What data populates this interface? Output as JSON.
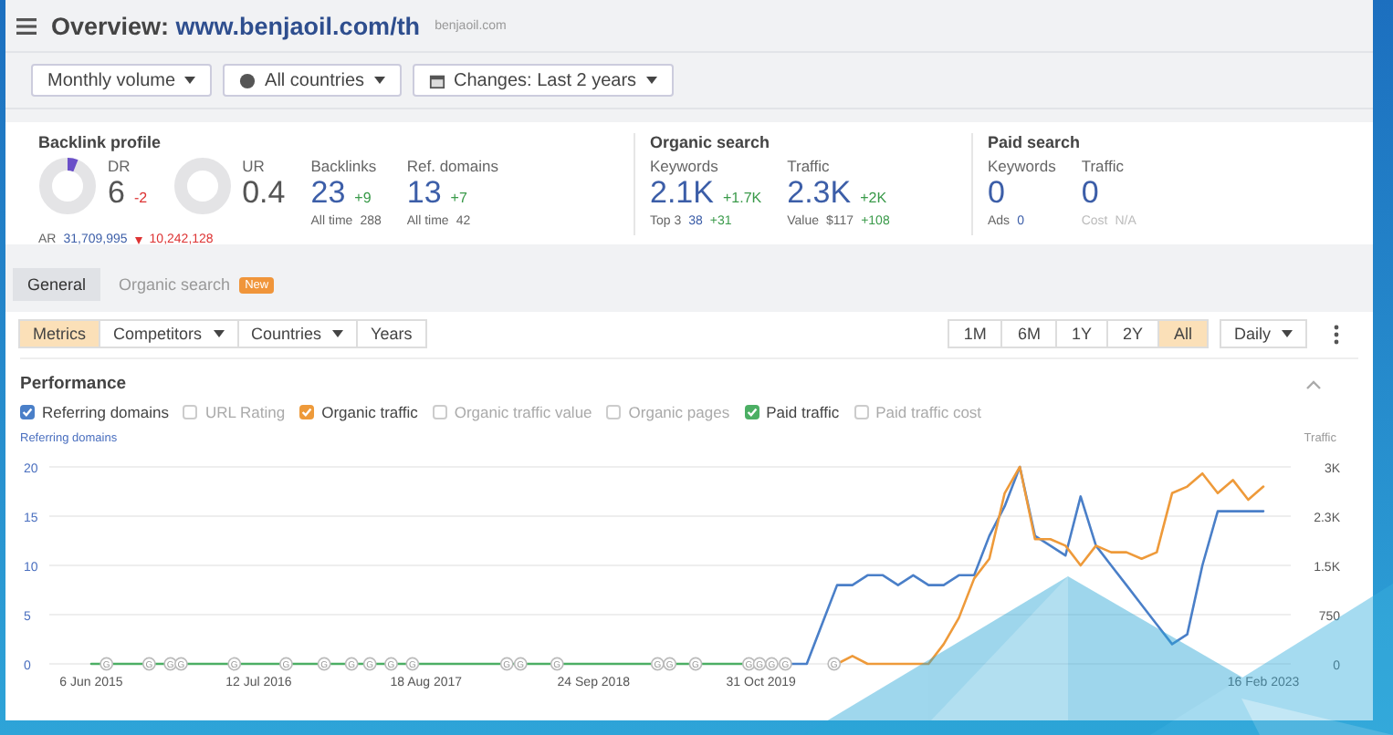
{
  "header": {
    "title": "Overview:",
    "url": "www.benjaoil.com/th",
    "domain": "benjaoil.com"
  },
  "filters": [
    {
      "label": "Monthly volume"
    },
    {
      "label": "All countries"
    },
    {
      "label": "Changes: Last 2 years"
    }
  ],
  "metric_groups": [
    {
      "title": "Backlink profile",
      "items": [
        {
          "kind": "gauge",
          "label": "DR",
          "value": "6",
          "change": "-2",
          "color": "#dd3333",
          "level": 0.06,
          "footer": {
            "label": "AR",
            "value": "31,709,995",
            "link": true,
            "change": "10,242,128",
            "color": "#dd3333"
          }
        },
        {
          "kind": "gauge",
          "label": "UR",
          "value": "0.4"
        },
        {
          "kind": "stat",
          "label": "Backlinks",
          "value": "23",
          "change": "+9",
          "color": "#3a9a4a",
          "footer": {
            "label": "All time",
            "value": "288",
            "link": false
          }
        },
        {
          "kind": "stat",
          "label": "Ref. domains",
          "value": "13",
          "change": "+7",
          "color": "#3a9a4a",
          "footer": {
            "label": "All time",
            "value": "42",
            "link": false
          }
        }
      ]
    },
    {
      "title": "Organic search",
      "items": [
        {
          "kind": "stat",
          "label": "Keywords",
          "value": "2.1K",
          "change": "+1.7K",
          "color": "#3a9a4a",
          "footer": {
            "label": "Top 3",
            "value": "38",
            "link": true,
            "change": "+31",
            "color": "#3a9a4a"
          }
        },
        {
          "kind": "stat",
          "label": "Traffic",
          "value": "2.3K",
          "change": "+2K",
          "color": "#3a9a4a",
          "footer": {
            "label": "Value",
            "value": "$117",
            "link": false,
            "change": "+108",
            "color": "#3a9a4a"
          }
        }
      ]
    },
    {
      "title": "Paid search",
      "items": [
        {
          "kind": "stat",
          "label": "Keywords",
          "value": "0",
          "footer": {
            "label": "Ads",
            "value": "0",
            "link": true
          }
        },
        {
          "kind": "stat",
          "label": "Traffic",
          "value": "0",
          "footer": {
            "label": "Cost",
            "value": "N/A",
            "link": false,
            "disabled": true
          }
        }
      ]
    }
  ],
  "tabs": [
    {
      "label": "General",
      "selected": true
    },
    {
      "label": "Organic search",
      "selected": false,
      "badge": "New"
    }
  ],
  "view_buttons": [
    {
      "label": "Metrics",
      "selected": true,
      "dropdown": false
    },
    {
      "label": "Competitors",
      "selected": false,
      "dropdown": true
    },
    {
      "label": "Countries",
      "selected": false,
      "dropdown": true
    },
    {
      "label": "Years",
      "selected": false,
      "dropdown": false
    }
  ],
  "ranges": [
    {
      "label": "1M",
      "selected": false
    },
    {
      "label": "6M",
      "selected": false
    },
    {
      "label": "1Y",
      "selected": false
    },
    {
      "label": "2Y",
      "selected": false
    },
    {
      "label": "All",
      "selected": true
    }
  ],
  "interval": "Daily",
  "performance": {
    "title": "Performance",
    "toggles": [
      {
        "label": "Referring domains",
        "checked": true,
        "color": "#4a7fc8"
      },
      {
        "label": "URL Rating",
        "checked": false
      },
      {
        "label": "Organic traffic",
        "checked": true,
        "color": "#ee9a3a"
      },
      {
        "label": "Organic traffic value",
        "checked": false
      },
      {
        "label": "Organic pages",
        "checked": false
      },
      {
        "label": "Paid traffic",
        "checked": true,
        "color": "#4caf64"
      },
      {
        "label": "Paid traffic cost",
        "checked": false
      }
    ],
    "chart_data": {
      "type": "line",
      "grid": true,
      "ylabel": "Referring domains",
      "y2label": "Traffic",
      "categories": [
        "6 Jun 2015",
        null,
        null,
        null,
        null,
        null,
        null,
        null,
        null,
        null,
        null,
        "12 Jul 2016",
        null,
        null,
        null,
        null,
        null,
        null,
        null,
        null,
        null,
        null,
        "18 Aug 2017",
        null,
        null,
        null,
        null,
        null,
        null,
        null,
        null,
        null,
        null,
        "24 Sep 2018",
        null,
        null,
        null,
        null,
        null,
        null,
        null,
        null,
        null,
        null,
        "31 Oct 2019",
        null,
        null,
        null,
        null,
        null,
        null,
        null,
        null,
        null,
        null,
        null,
        null,
        null,
        null,
        null,
        null,
        null,
        null,
        null,
        null,
        null,
        null,
        null,
        null,
        null,
        null,
        null,
        null,
        null,
        null,
        null,
        null,
        "16 Feb 2023"
      ],
      "ylim": [
        0,
        20
      ],
      "yticks": [
        0,
        5,
        10,
        15,
        20
      ],
      "y2lim": [
        0,
        3000
      ],
      "y2ticks": [
        {
          "value": 0,
          "label": "0"
        },
        {
          "value": 750,
          "label": "750"
        },
        {
          "value": 1500,
          "label": "1.5K"
        },
        {
          "value": 2250,
          "label": "2.3K"
        },
        {
          "value": 3000,
          "label": "3K"
        }
      ],
      "series": [
        {
          "color": "#4a7fc8",
          "values": [
            null,
            null,
            null,
            null,
            null,
            null,
            null,
            null,
            null,
            null,
            null,
            null,
            null,
            null,
            null,
            null,
            null,
            null,
            null,
            null,
            null,
            null,
            null,
            null,
            null,
            null,
            null,
            null,
            null,
            null,
            null,
            null,
            null,
            null,
            null,
            null,
            null,
            null,
            null,
            null,
            null,
            null,
            null,
            null,
            null,
            null,
            0,
            0,
            4,
            8,
            8,
            9,
            9,
            8,
            9,
            8,
            8,
            9,
            9,
            13,
            16,
            20,
            13,
            12,
            11,
            17,
            12,
            10,
            8,
            6,
            4,
            2,
            3,
            10,
            15.5,
            15.5,
            15.5,
            15.5
          ]
        },
        {
          "color": "#ee9a3a",
          "axis": "y2",
          "values": [
            null,
            null,
            null,
            null,
            null,
            null,
            null,
            null,
            null,
            null,
            null,
            null,
            null,
            null,
            null,
            null,
            null,
            null,
            null,
            null,
            null,
            null,
            null,
            null,
            null,
            null,
            null,
            null,
            null,
            null,
            null,
            null,
            null,
            null,
            null,
            null,
            null,
            null,
            null,
            null,
            null,
            null,
            null,
            null,
            null,
            null,
            null,
            null,
            null,
            0,
            120,
            0,
            0,
            0,
            0,
            0,
            300,
            700,
            1300,
            1600,
            2600,
            3000,
            1900,
            1900,
            1800,
            1500,
            1800,
            1700,
            1700,
            1600,
            1700,
            2600,
            2700,
            2900,
            2600,
            2800,
            2500,
            2700
          ]
        },
        {
          "color": "#4caf64",
          "axis": "y2",
          "values": [
            0,
            0,
            0,
            0,
            0,
            0,
            0,
            0,
            0,
            0,
            0,
            0,
            0,
            0,
            0,
            0,
            0,
            0,
            0,
            0,
            0,
            0,
            0,
            0,
            0,
            0,
            0,
            0,
            0,
            0,
            0,
            0,
            0,
            0,
            0,
            0,
            0,
            0,
            0,
            0,
            0,
            0,
            0,
            0,
            0,
            0,
            null,
            null,
            null,
            null,
            null,
            null,
            null,
            null,
            null,
            null,
            null,
            null,
            null,
            null,
            null,
            null,
            null,
            null,
            null,
            null,
            null,
            null,
            null,
            null,
            null,
            null,
            null,
            null,
            null,
            null,
            null,
            null
          ]
        }
      ],
      "annotations": [
        {
          "text": "G"
        },
        {
          "text": "G"
        },
        {
          "text": "G"
        },
        {
          "text": "G"
        },
        {
          "text": "G"
        },
        {
          "text": "G"
        },
        {
          "text": "G"
        },
        {
          "text": "G"
        },
        {
          "text": "G"
        },
        {
          "text": "G"
        },
        {
          "text": "G"
        },
        {
          "text": "G"
        },
        {
          "text": "G"
        },
        {
          "text": "G"
        },
        {
          "text": "G"
        },
        {
          "text": "G"
        },
        {
          "text": "G"
        },
        {
          "text": "G"
        },
        {
          "text": "G"
        },
        {
          "text": "G"
        },
        {
          "text": "G"
        },
        {
          "text": "G"
        }
      ]
    }
  }
}
